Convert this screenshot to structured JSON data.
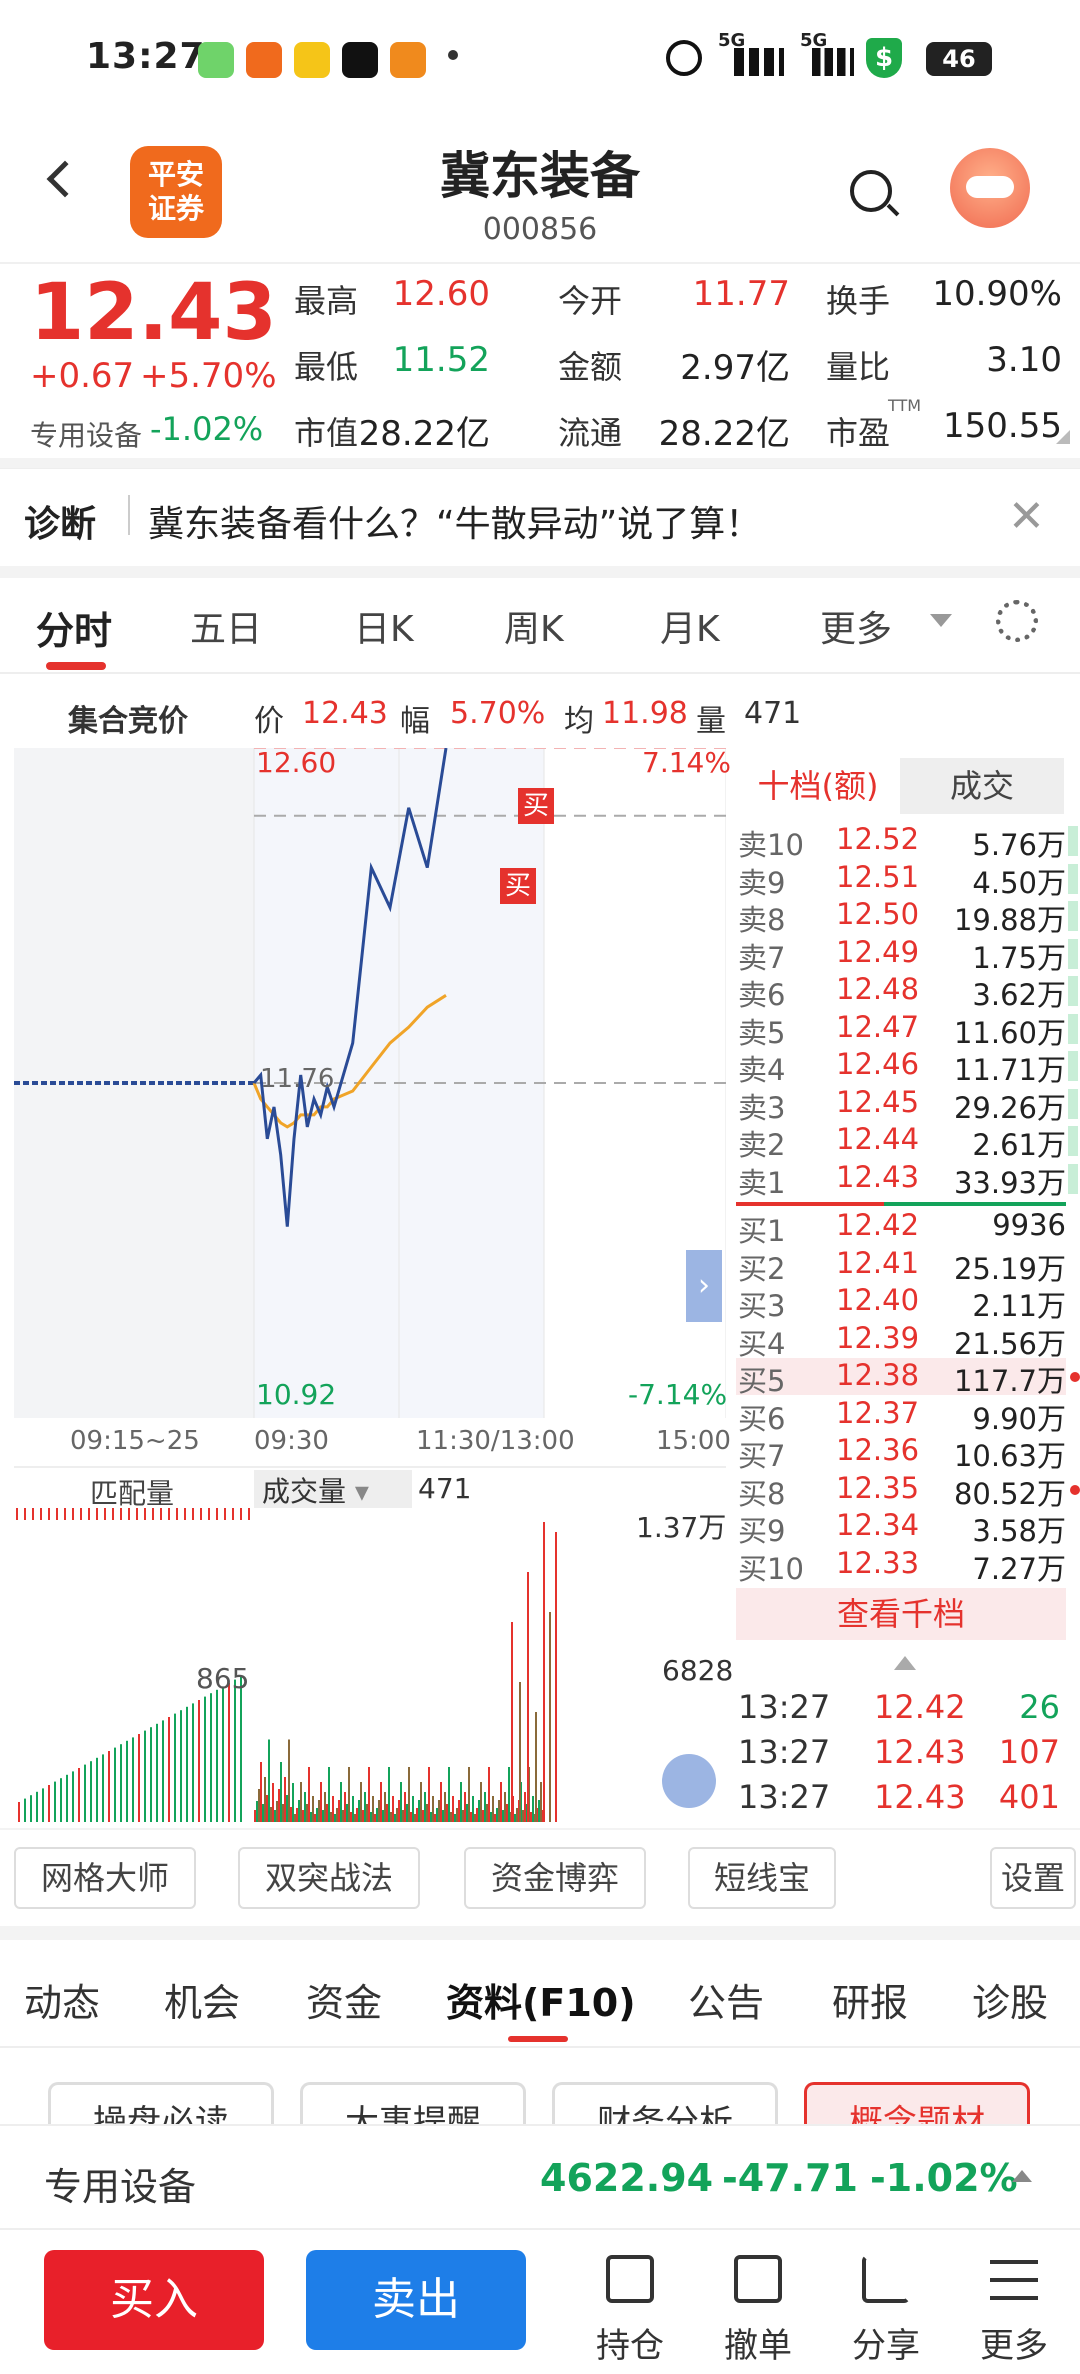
{
  "status": {
    "time": "13:27",
    "battery": "46",
    "network1": "5G",
    "network2": "5G"
  },
  "header": {
    "title": "冀东装备",
    "code": "000856",
    "logo_text": "平安\n证券"
  },
  "quote": {
    "price": "12.43",
    "change": "+0.67",
    "change_pct": "+5.70%",
    "sector": "专用设备",
    "sector_pct": "-1.02%",
    "fields": [
      {
        "label": "最高",
        "value": "12.60",
        "color": "red"
      },
      {
        "label": "今开",
        "value": "11.77",
        "color": "red"
      },
      {
        "label": "换手",
        "value": "10.90%",
        "color": "dark"
      },
      {
        "label": "最低",
        "value": "11.52",
        "color": "green"
      },
      {
        "label": "金额",
        "value": "2.97亿",
        "color": "dark"
      },
      {
        "label": "量比",
        "value": "3.10",
        "color": "dark"
      },
      {
        "label": "市值",
        "value": "28.22亿",
        "color": "dark"
      },
      {
        "label": "流通",
        "value": "28.22亿",
        "color": "dark"
      },
      {
        "label": "市盈",
        "value": "150.55",
        "color": "dark"
      }
    ],
    "ttm": "TTM"
  },
  "diagnosis": {
    "label": "诊断",
    "text": "冀东装备看什么？“牛散异动”说了算！"
  },
  "chart_tabs": [
    "分时",
    "五日",
    "日K",
    "周K",
    "月K",
    "更多"
  ],
  "ticker": {
    "label": "集合竞价",
    "price_label": "价",
    "price": "12.43",
    "pct_label": "幅",
    "pct": "5.70%",
    "avg_label": "均",
    "avg": "11.98",
    "vol_label": "量",
    "vol": "471"
  },
  "chart_labels": {
    "high": "12.60",
    "high_pct": "7.14%",
    "low": "10.92",
    "low_pct": "-7.14%",
    "prev": "11.76",
    "times": [
      "09:15~25",
      "09:30",
      "11:30/13:00",
      "15:00"
    ],
    "vol_max": "1.37万",
    "vol_mid": "6828",
    "auction_vol": "865",
    "match_label": "匹配量",
    "vol_select": "成交量",
    "vol_value": "471",
    "buy_tag": "买"
  },
  "chart_data": {
    "type": "line",
    "title": "",
    "series": [
      {
        "name": "价",
        "values": [
          11.76,
          11.78,
          11.62,
          11.7,
          11.58,
          11.4,
          11.62,
          11.78,
          11.65,
          11.72,
          11.68,
          11.75,
          11.7,
          11.86,
          12.3,
          12.2,
          12.45,
          12.3,
          12.6
        ]
      },
      {
        "name": "均",
        "values": [
          11.76,
          11.72,
          11.7,
          11.68,
          11.66,
          11.65,
          11.66,
          11.68,
          11.68,
          11.68,
          11.7,
          11.7,
          11.72,
          11.74,
          11.8,
          11.86,
          11.9,
          11.95,
          11.98
        ]
      }
    ],
    "ylim": [
      10.92,
      12.6
    ],
    "prev_close": 11.76
  },
  "orderbook": {
    "tabs": [
      "十档(额)",
      "成交"
    ],
    "sell": [
      {
        "l": "卖10",
        "p": "12.52",
        "v": "5.76万"
      },
      {
        "l": "卖9",
        "p": "12.51",
        "v": "4.50万"
      },
      {
        "l": "卖8",
        "p": "12.50",
        "v": "19.88万"
      },
      {
        "l": "卖7",
        "p": "12.49",
        "v": "1.75万"
      },
      {
        "l": "卖6",
        "p": "12.48",
        "v": "3.62万"
      },
      {
        "l": "卖5",
        "p": "12.47",
        "v": "11.60万"
      },
      {
        "l": "卖4",
        "p": "12.46",
        "v": "11.71万"
      },
      {
        "l": "卖3",
        "p": "12.45",
        "v": "29.26万"
      },
      {
        "l": "卖2",
        "p": "12.44",
        "v": "2.61万"
      },
      {
        "l": "卖1",
        "p": "12.43",
        "v": "33.93万"
      }
    ],
    "buy": [
      {
        "l": "买1",
        "p": "12.42",
        "v": "9936"
      },
      {
        "l": "买2",
        "p": "12.41",
        "v": "25.19万"
      },
      {
        "l": "买3",
        "p": "12.40",
        "v": "2.11万"
      },
      {
        "l": "买4",
        "p": "12.39",
        "v": "21.56万"
      },
      {
        "l": "买5",
        "p": "12.38",
        "v": "117.7万"
      },
      {
        "l": "买6",
        "p": "12.37",
        "v": "9.90万"
      },
      {
        "l": "买7",
        "p": "12.36",
        "v": "10.63万"
      },
      {
        "l": "买8",
        "p": "12.35",
        "v": "80.52万"
      },
      {
        "l": "买9",
        "p": "12.34",
        "v": "3.58万"
      },
      {
        "l": "买10",
        "p": "12.33",
        "v": "7.27万"
      }
    ],
    "more": "查看千档",
    "trades": [
      {
        "t": "13:27",
        "p": "12.42",
        "v": "26",
        "vc": "green"
      },
      {
        "t": "13:27",
        "p": "12.43",
        "v": "107",
        "vc": "red"
      },
      {
        "t": "13:27",
        "p": "12.43",
        "v": "401",
        "vc": "red"
      }
    ]
  },
  "tools": [
    "网格大师",
    "双突战法",
    "资金博弈",
    "短线宝",
    "设置"
  ],
  "f10_tabs": [
    "动态",
    "机会",
    "资金",
    "资料(F10)",
    "公告",
    "研报",
    "诊股"
  ],
  "sub_buttons": [
    "操盘必读",
    "大事提醒",
    "财务分析",
    "概念题材"
  ],
  "sector_bar": {
    "name": "专用设备",
    "value": "4622.94",
    "change": "-47.71",
    "pct": "-1.02%"
  },
  "bottom": {
    "buy": "买入",
    "sell": "卖出",
    "items": [
      "持仓",
      "撤单",
      "分享",
      "更多"
    ]
  }
}
